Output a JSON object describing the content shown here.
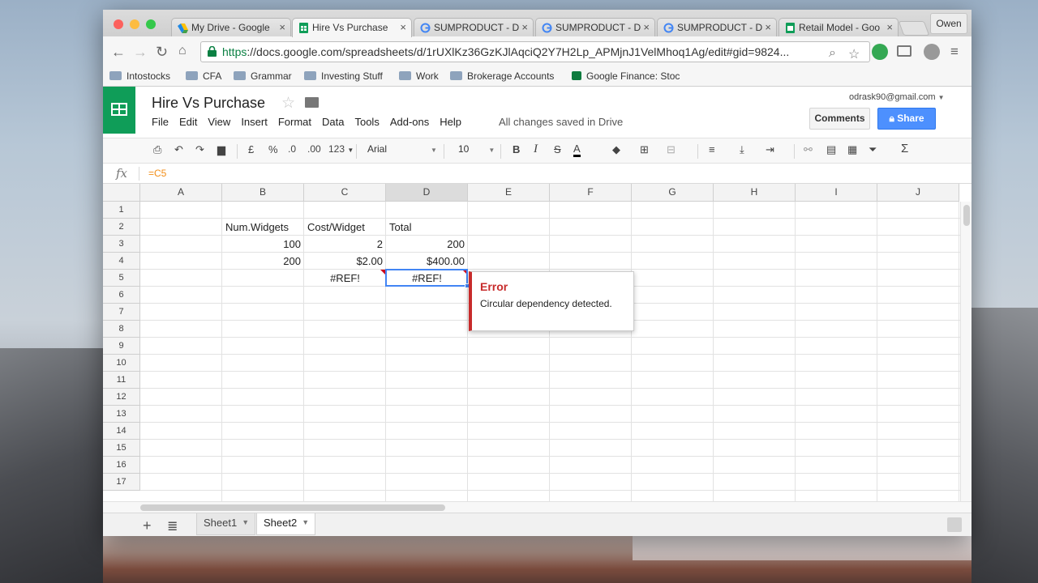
{
  "browser": {
    "tabs": [
      {
        "title": "My Drive - Google"
      },
      {
        "title": "Hire Vs Purchase"
      },
      {
        "title": "SUMPRODUCT - D"
      },
      {
        "title": "SUMPRODUCT - D"
      },
      {
        "title": "SUMPRODUCT - D"
      },
      {
        "title": "Retail Model - Goo"
      }
    ],
    "profile": "Owen",
    "url_scheme": "https",
    "url_rest": "://docs.google.com/spreadsheets/d/1rUXlKz36GzKJlAqciQ2Y7H2Lp_APMjnJ1VelMhoq1Ag/edit#gid=9824...",
    "bookmarks": [
      "Intostocks",
      "CFA",
      "Grammar",
      "Investing Stuff",
      "Work",
      "Brokerage Accounts",
      "Google Finance: Stoc"
    ]
  },
  "doc": {
    "title": "Hire Vs Purchase",
    "menus": [
      "File",
      "Edit",
      "View",
      "Insert",
      "Format",
      "Data",
      "Tools",
      "Add-ons",
      "Help"
    ],
    "save_status": "All changes saved in Drive",
    "account": "odrask90@gmail.com",
    "comments_label": "Comments",
    "share_label": "Share"
  },
  "toolbar": {
    "currency": "£",
    "percent": "%",
    "dec_less": ".0",
    "dec_more": ".00",
    "more_formats": "123",
    "font": "Arial",
    "font_size": "10",
    "bold": "B",
    "italic": "I",
    "strike": "S",
    "text_color": "A",
    "sum": "Σ"
  },
  "formula_bar": {
    "fx": "fx",
    "formula": "=C5"
  },
  "sheet": {
    "columns": [
      "A",
      "B",
      "C",
      "D",
      "E",
      "F",
      "G",
      "H",
      "I",
      "J"
    ],
    "selected_column": "D",
    "rows": [
      "1",
      "2",
      "3",
      "4",
      "5",
      "6",
      "7",
      "8",
      "9",
      "10",
      "11",
      "12",
      "13",
      "14",
      "15",
      "16",
      "17"
    ],
    "cells": {
      "B2": "Num.Widgets",
      "C2": "Cost/Widget",
      "D2": "Total",
      "B3": "100",
      "C3": "2",
      "D3": "200",
      "B4": "200",
      "C4": "$2.00",
      "D4": "$400.00",
      "C5": "#REF!",
      "D5": "#REF!"
    },
    "active_cell": "D5"
  },
  "error_popup": {
    "title": "Error",
    "message": "Circular dependency detected."
  },
  "sheet_tabs": [
    {
      "name": "Sheet1",
      "active": false
    },
    {
      "name": "Sheet2",
      "active": true
    }
  ],
  "colors": {
    "accent_green": "#0f9d58",
    "share_blue": "#4d90fe",
    "error_red": "#c72b2b",
    "selection_blue": "#4285f4"
  }
}
